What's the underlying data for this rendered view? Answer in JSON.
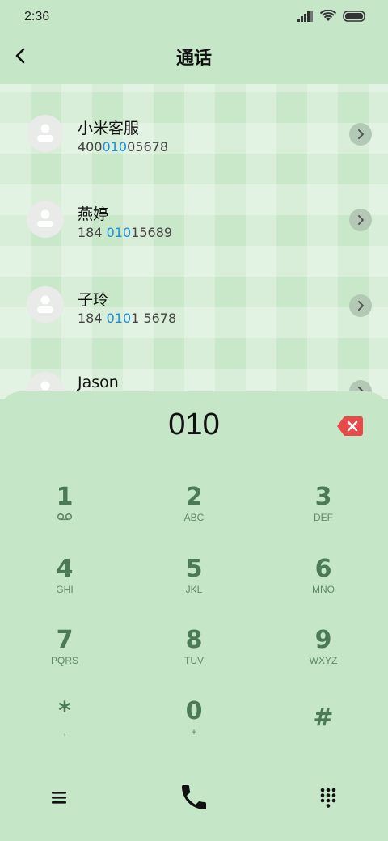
{
  "status": {
    "time": "2:36"
  },
  "header": {
    "title": "通话"
  },
  "contacts": [
    {
      "name": "小米客服",
      "num_pre": "400",
      "num_hl": "010",
      "num_post": "05678"
    },
    {
      "name": "燕婷",
      "num_pre": "184 ",
      "num_hl": "010",
      "num_post": "15689"
    },
    {
      "name": "子玲",
      "num_pre": "184 ",
      "num_hl": "010",
      "num_post": "1 5678"
    },
    {
      "name": "Jason",
      "num_pre": "",
      "num_hl": "",
      "num_post": ""
    }
  ],
  "dialer": {
    "value": "010",
    "keys": [
      {
        "digit": "1",
        "letters": ""
      },
      {
        "digit": "2",
        "letters": "ABC"
      },
      {
        "digit": "3",
        "letters": "DEF"
      },
      {
        "digit": "4",
        "letters": "GHI"
      },
      {
        "digit": "5",
        "letters": "JKL"
      },
      {
        "digit": "6",
        "letters": "MNO"
      },
      {
        "digit": "7",
        "letters": "PQRS"
      },
      {
        "digit": "8",
        "letters": "TUV"
      },
      {
        "digit": "9",
        "letters": "WXYZ"
      },
      {
        "digit": "*",
        "letters": ","
      },
      {
        "digit": "0",
        "letters": "+"
      },
      {
        "digit": "#",
        "letters": ""
      }
    ]
  },
  "colors": {
    "highlight": "#1a8fe0",
    "delete": "#e84a4a",
    "key": "#4b7a55"
  },
  "icons": [
    "signal-icon",
    "wifi-icon",
    "battery-icon",
    "back-icon",
    "avatar-icon",
    "chevron-right-icon",
    "delete-icon",
    "voicemail-icon",
    "menu-icon",
    "call-icon",
    "dialpad-icon"
  ]
}
